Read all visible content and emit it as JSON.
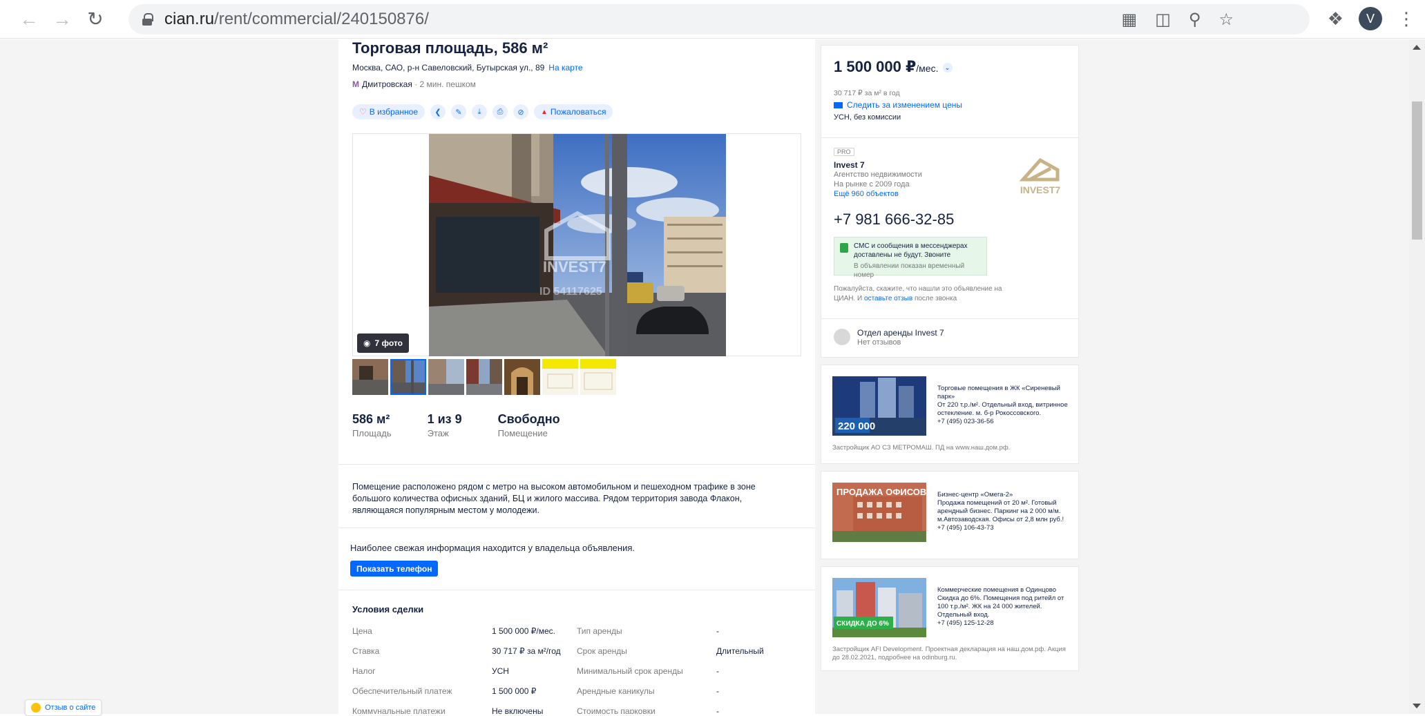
{
  "browser": {
    "url_host": "cian.ru",
    "url_path": "/rent/commercial/240150876/",
    "profile_initial": "V"
  },
  "listing": {
    "title": "Торговая площадь, 586 м²",
    "address": "Москва, САО, р-н Савеловский, Бутырская ул., 89",
    "map_link": "На карте",
    "metro_station": "Дмитровская",
    "metro_distance": "· 2 мин. пешком",
    "favorite": "В избранное",
    "report": "Пожаловаться",
    "photo_count": "7 фото",
    "watermark_brand": "INVEST7",
    "watermark_id": "ID 54117625",
    "facts": [
      {
        "value": "586 м²",
        "label": "Площадь"
      },
      {
        "value": "1 из 9",
        "label": "Этаж"
      },
      {
        "value": "Свободно",
        "label": "Помещение"
      }
    ],
    "description": "Помещение расположено рядом с метро на высоком автомобильном и пешеходном трафике в зоне большого количества офисных зданий, БЦ и жилого массива. Рядом территория завода Флакон, являющаяся популярным местом у молодежи.",
    "fresh_info": "Наиболее свежая информация находится у владельца объявления.",
    "show_phone": "Показать телефон",
    "deal_title": "Условия сделки",
    "deal_rows": [
      {
        "k1": "Цена",
        "v1": "1 500 000 ₽/мес.",
        "k2": "Тип аренды",
        "v2": "-"
      },
      {
        "k1": "Ставка",
        "v1": "30 717 ₽ за м²/год",
        "k2": "Срок аренды",
        "v2": "Длительный"
      },
      {
        "k1": "Налог",
        "v1": "УСН",
        "k2": "Минимальный срок аренды",
        "v2": "-"
      },
      {
        "k1": "Обеспечительный платеж",
        "v1": "1 500 000 ₽",
        "k2": "Арендные каникулы",
        "v2": "-"
      },
      {
        "k1": "Коммунальные платежи",
        "v1": "Не включены",
        "k2": "Стоимость парковки",
        "v2": "-"
      }
    ]
  },
  "sidebar": {
    "price": "1 500 000 ₽",
    "price_unit": "/мес.",
    "per_meter": "30 717 ₽ за м² в год",
    "follow_price": "Следить за изменением цены",
    "terms": "УСН, без комиссии",
    "agent_badge": "PRO",
    "agent_name": "Invest 7",
    "agent_type": "Агентство недвижимости",
    "agent_since": "На рынке с 2009 года",
    "agent_more": "Ещё 960 объектов",
    "agent_logo_text": "INVEST7",
    "phone": "+7 981 666-32-85",
    "sms_notice": "СМС и сообщения в мессенджерах доставлены не будут. Звоните",
    "sms_sub": "В объявлении показан временный номер",
    "ask_prefix": "Пожалуйста, скажите, что нашли это объявление на ЦИАН. И",
    "ask_link": "оставьте отзыв",
    "ask_suffix": "после звонка",
    "dept_name": "Отдел аренды Invest 7",
    "dept_reviews": "Нет отзывов"
  },
  "ads": [
    {
      "title": "Торговые помещения в ЖК «Сиреневый парк»",
      "text": "От 220 т.р./м². Отдельный вход, витринное остекление. м. б-р Рокоссовского.",
      "phone": "+7 (495) 023-36-56",
      "badge": "220 000",
      "foot": "Застройщик АО СЗ МЕТРОМАШ. ПД на www.наш.дом.рф."
    },
    {
      "title": "Бизнес-центр «Омега-2»",
      "text": "Продажа помещений от 20 м². Готовый арендный бизнес. Паркинг на 2 000 м/м. м.Автозаводская. Офисы от 2,8 млн руб.!",
      "phone": "+7 (495) 106-43-73",
      "badge": "ПРОДАЖА ОФИСОВ",
      "foot": ""
    },
    {
      "title": "Коммерческие помещения в Одинцово",
      "text": "Скидка до 6%. Помещения под ритейл от 100 т.р./м². ЖК на 24 000 жителей. Отдельный вход.",
      "phone": "+7 (495) 125-12-28",
      "badge": "СКИДКА ДО 6%",
      "foot": "Застройщик AFI Development. Проектная декларация на наш.дом.рф. Акция до 28.02.2021, подробнее на odinburg.ru."
    }
  ],
  "feedback": "Отзыв о сайте"
}
